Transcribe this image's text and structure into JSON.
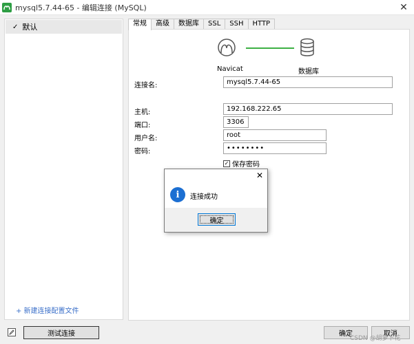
{
  "window": {
    "title": "mysql5.7.44-65 - 编辑连接 (MySQL)",
    "close_glyph": "✕"
  },
  "sidebar": {
    "items": [
      {
        "label": "默认",
        "check": "✓"
      }
    ],
    "new_config_label": "+ 新建连接配置文件"
  },
  "tabs": [
    {
      "label": "常规"
    },
    {
      "label": "高级"
    },
    {
      "label": "数据库"
    },
    {
      "label": "SSL"
    },
    {
      "label": "SSH"
    },
    {
      "label": "HTTP"
    }
  ],
  "graphic": {
    "left_label": "Navicat",
    "right_label": "数据库"
  },
  "form": {
    "connection_name": {
      "label": "连接名:",
      "value": "mysql5.7.44-65"
    },
    "host": {
      "label": "主机:",
      "value": "192.168.222.65"
    },
    "port": {
      "label": "端口:",
      "value": "3306"
    },
    "username": {
      "label": "用户名:",
      "value": "root"
    },
    "password": {
      "label": "密码:",
      "value": "••••••••"
    },
    "save_password": {
      "label": "保存密码",
      "check": "✓"
    }
  },
  "dialog": {
    "message": "连接成功",
    "ok_label": "确定",
    "close_glyph": "✕",
    "icon_glyph": "i"
  },
  "footer": {
    "test_label": "测试连接",
    "ok_label": "确定",
    "cancel_label": "取消"
  },
  "watermark": "CSDN @胡萝卜花"
}
